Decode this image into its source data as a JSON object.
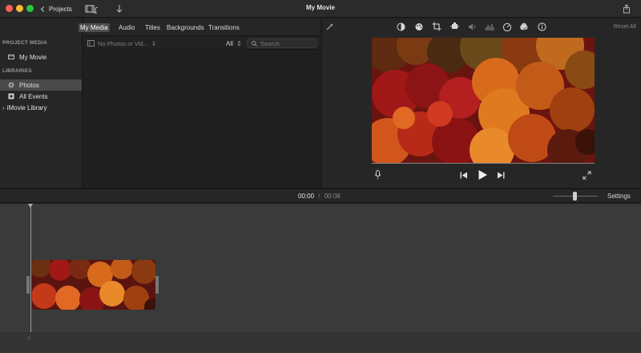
{
  "window": {
    "title": "My Movie",
    "projects_label": "Projects"
  },
  "tabs": [
    "My Media",
    "Audio",
    "Titles",
    "Backgrounds",
    "Transitions"
  ],
  "active_tab": "My Media",
  "sidebar": {
    "project_media_header": "PROJECT MEDIA",
    "project_item": "My Movie",
    "libraries_header": "LIBRARIES",
    "items": [
      "Photos",
      "All Events",
      "iMovie Library"
    ],
    "selected": "Photos"
  },
  "media_filter": {
    "scope_label": "No Photos or Vid...",
    "filter_value": "All",
    "search_placeholder": "Search"
  },
  "viewer": {
    "reset_all_label": "Reset All",
    "tools": [
      "color-balance-icon",
      "color-correction-icon",
      "crop-icon",
      "stabilization-icon",
      "volume-icon",
      "noise-reduction-icon",
      "speed-icon",
      "clip-filter-icon",
      "info-icon"
    ]
  },
  "timeline": {
    "current_time": "00:00",
    "separator": "/",
    "total_time": "00:08",
    "settings_label": "Settings"
  },
  "colors": {
    "accent": "#ff5f57",
    "selection": "#4a4a4a",
    "timeline_bg": "#3a3a3a"
  }
}
